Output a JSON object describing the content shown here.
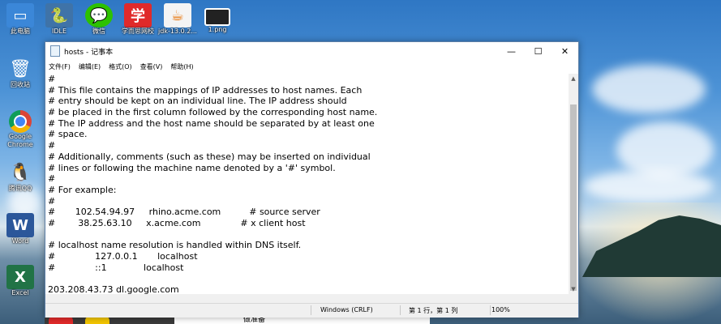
{
  "desktop": {
    "icons": [
      {
        "label": "此电脑",
        "icon": "computer-icon",
        "color": "#3b87d8"
      },
      {
        "label": "IDLE",
        "icon": "python-icon",
        "color": "#3f73a8"
      },
      {
        "label": "微信",
        "icon": "wechat-icon",
        "color": "#2dc100"
      },
      {
        "label": "学而思网校",
        "icon": "xueersi-icon",
        "color": "#e02a2a"
      },
      {
        "label": "jdk-13.0.2...",
        "icon": "java-icon",
        "color": "#e76f00"
      },
      {
        "label": "1.png",
        "icon": "image-file-icon",
        "color": "#222222"
      },
      {
        "label": "回收站",
        "icon": "recycle-bin-icon",
        "color": "#9fb6c8"
      },
      {
        "label": "Google Chrome",
        "icon": "chrome-icon",
        "color": "#db4437"
      },
      {
        "label": "腾讯QQ",
        "icon": "qq-icon",
        "color": "#111111"
      },
      {
        "label": "Word",
        "icon": "word-icon",
        "color": "#2b579a"
      },
      {
        "label": "Excel",
        "icon": "excel-icon",
        "color": "#217346"
      }
    ],
    "bottom_text": "做准备"
  },
  "window": {
    "title": "hosts - 记事本",
    "menu": [
      "文件(F)",
      "编辑(E)",
      "格式(O)",
      "查看(V)",
      "帮助(H)"
    ],
    "lines": [
      "#",
      "# This file contains the mappings of IP addresses to host names. Each",
      "# entry should be kept on an individual line. The IP address should",
      "# be placed in the first column followed by the corresponding host name.",
      "# The IP address and the host name should be separated by at least one",
      "# space.",
      "#",
      "# Additionally, comments (such as these) may be inserted on individual",
      "# lines or following the machine name denoted by a '#' symbol.",
      "#",
      "# For example:",
      "#",
      "#       102.54.94.97     rhino.acme.com          # source server",
      "#        38.25.63.10     x.acme.com              # x client host",
      "",
      "# localhost name resolution is handled within DNS itself.",
      "#              127.0.0.1       localhost",
      "#              ::1             localhost",
      "",
      "203.208.43.73 dl.google.com"
    ],
    "status": {
      "encoding": "Windows (CRLF)",
      "position": "第 1 行，第 1 列",
      "zoom": "100%"
    }
  }
}
